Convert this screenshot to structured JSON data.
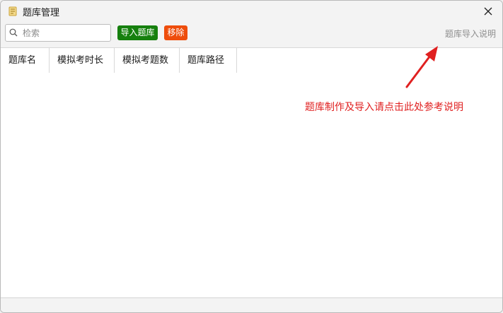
{
  "window": {
    "title": "题库管理"
  },
  "toolbar": {
    "search_placeholder": "检索",
    "import_label": "导入题库",
    "remove_label": "移除",
    "help_link": "题库导入说明"
  },
  "table": {
    "columns": [
      "题库名",
      "模拟考时长",
      "模拟考题数",
      "题库路径"
    ],
    "rows": []
  },
  "annotation": {
    "text": "题库制作及导入请点击此处参考说明"
  },
  "colors": {
    "import_button": "#16800e",
    "remove_button": "#ee4d0c",
    "annotation": "#e02020",
    "help_link": "#8e8e8e"
  },
  "icons": [
    "app-icon",
    "search-icon",
    "close-icon",
    "arrow-icon"
  ]
}
